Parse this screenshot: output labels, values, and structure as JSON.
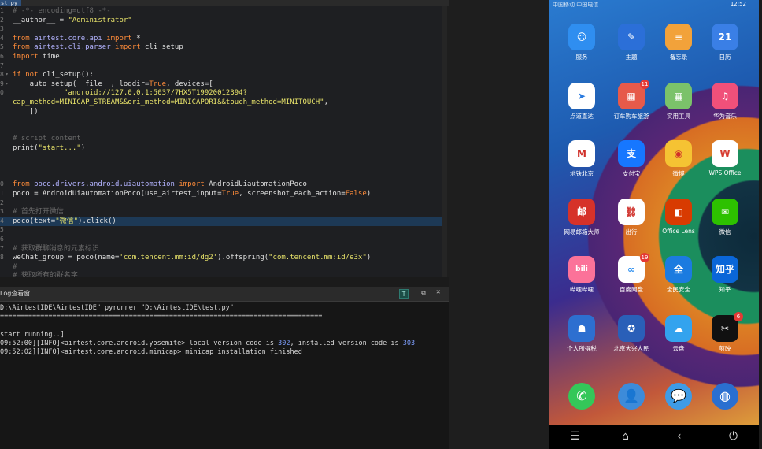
{
  "ide": {
    "tab_label": "st.py",
    "editor_lines": [
      {
        "n": "1",
        "parts": [
          [
            "cmt",
            "# -*- encoding=utf8 -*-"
          ]
        ]
      },
      {
        "n": "2",
        "parts": [
          [
            "plain",
            "__author__ = "
          ],
          [
            "str",
            "\"Administrator\""
          ]
        ]
      },
      {
        "n": "3",
        "parts": []
      },
      {
        "n": "4",
        "parts": [
          [
            "kw",
            "from "
          ],
          [
            "mod",
            "airtest.core.api"
          ],
          [
            "kw",
            " import "
          ],
          [
            "plain",
            "*"
          ]
        ]
      },
      {
        "n": "5",
        "parts": [
          [
            "kw",
            "from "
          ],
          [
            "mod",
            "airtest.cli.parser"
          ],
          [
            "kw",
            " import "
          ],
          [
            "plain",
            "cli_setup"
          ]
        ]
      },
      {
        "n": "6",
        "parts": [
          [
            "kw",
            "import "
          ],
          [
            "plain",
            "time"
          ]
        ]
      },
      {
        "n": "7",
        "parts": []
      },
      {
        "n": "8",
        "fold": true,
        "parts": [
          [
            "kw",
            "if not "
          ],
          [
            "plain",
            "cli_setup():"
          ]
        ]
      },
      {
        "n": "9",
        "fold": true,
        "parts": [
          [
            "plain",
            "    auto_setup(__file__, logdir="
          ],
          [
            "kw",
            "True"
          ],
          [
            "plain",
            ", devices=["
          ]
        ]
      },
      {
        "n": "0",
        "parts": [
          [
            "str",
            "            \"android://127.0.0.1:5037/7HX5T19920012394?"
          ]
        ]
      },
      {
        "n": "",
        "parts": [
          [
            "str",
            "cap_method=MINICAP_STREAM&&ori_method=MINICAPORI&&touch_method=MINITOUCH\""
          ],
          [
            "plain",
            ","
          ]
        ]
      },
      {
        "n": "",
        "parts": [
          [
            "plain",
            "    ])"
          ]
        ]
      },
      {
        "n": "",
        "parts": []
      },
      {
        "n": "",
        "parts": []
      },
      {
        "n": "",
        "parts": [
          [
            "cmt",
            "# script content"
          ]
        ]
      },
      {
        "n": "",
        "parts": [
          [
            "plain",
            "print("
          ],
          [
            "str",
            "\"start...\""
          ],
          [
            "plain",
            ")"
          ]
        ]
      },
      {
        "n": "",
        "parts": []
      },
      {
        "n": "",
        "parts": []
      },
      {
        "n": "",
        "parts": []
      },
      {
        "n": "0",
        "parts": [
          [
            "kw",
            "from "
          ],
          [
            "mod",
            "poco.drivers.android.uiautomation"
          ],
          [
            "kw",
            " import "
          ],
          [
            "plain",
            "AndroidUiautomationPoco"
          ]
        ]
      },
      {
        "n": "1",
        "parts": [
          [
            "plain",
            "poco = AndroidUiautomationPoco(use_airtest_input="
          ],
          [
            "kw",
            "True"
          ],
          [
            "plain",
            ", screenshot_each_action="
          ],
          [
            "kw",
            "False"
          ],
          [
            "plain",
            ")"
          ]
        ]
      },
      {
        "n": "2",
        "parts": []
      },
      {
        "n": "3",
        "parts": [
          [
            "cmt",
            "# 首先打开微信"
          ]
        ]
      },
      {
        "n": "4",
        "hl": true,
        "parts": [
          [
            "plain",
            "poco(text="
          ],
          [
            "str",
            "\"微信\""
          ],
          [
            "plain",
            ").click()"
          ]
        ]
      },
      {
        "n": "5",
        "parts": []
      },
      {
        "n": "6",
        "parts": []
      },
      {
        "n": "7",
        "parts": [
          [
            "cmt",
            "# 获取群聊消息的元素标识"
          ]
        ]
      },
      {
        "n": "8",
        "parts": [
          [
            "plain",
            "weChat_group = poco(name="
          ],
          [
            "str",
            "'com.tencent.mm:id/dg2'"
          ],
          [
            "plain",
            ").offspring("
          ],
          [
            "str",
            "\"com.tencent.mm:id/e3x\""
          ],
          [
            "plain",
            ")"
          ]
        ]
      },
      {
        "n": "",
        "parts": [
          [
            "cmt",
            "#"
          ]
        ]
      },
      {
        "n": "",
        "parts": [
          [
            "cmt",
            "# 获取所有的群名字"
          ]
        ]
      }
    ]
  },
  "log": {
    "title": "Log查看窗",
    "btn_t": "T",
    "restore_icon": "⧉",
    "close_icon": "✕",
    "lines": [
      [
        [
          "plain",
          "D:\\AirtestIDE\\AirtestIDE\" pyrunner \"D:\\AirtestIDE\\test.py\""
        ]
      ],
      [
        [
          "plain",
          "================================================================================"
        ]
      ],
      [],
      [
        [
          "plain",
          "start running..]"
        ]
      ],
      [
        [
          "plain",
          "09:52:00][INFO]<airtest.core.android.yosemite> local version code is "
        ],
        [
          "num",
          "302"
        ],
        [
          "plain",
          ", installed version code is "
        ],
        [
          "num",
          "303"
        ]
      ],
      [
        [
          "plain",
          "09:52:02][INFO]<airtest.core.android.minicap> minicap installation finished"
        ]
      ]
    ]
  },
  "phone": {
    "status_left": "中国移动 中国电信",
    "status_time": "12:52",
    "apps": [
      {
        "name": "app-service",
        "label": "服务",
        "icon": "☺",
        "color": "#2f8ef0",
        "col": 0,
        "row": 0
      },
      {
        "name": "app-theme",
        "label": "主题",
        "icon": "✎",
        "color": "#2b6fd8",
        "col": 1,
        "row": 0
      },
      {
        "name": "app-memo",
        "label": "备忘录",
        "icon": "≡",
        "color": "#f2a23a",
        "col": 2,
        "row": 0
      },
      {
        "name": "app-calendar",
        "label": "日历",
        "icon": "21",
        "color": "#3a7fe6",
        "col": 3,
        "row": 0
      },
      {
        "name": "app-direct",
        "label": "点道直达",
        "icon": "➤",
        "color": "#ffffff",
        "fg": "#2a7be0",
        "col": 0,
        "row": 1
      },
      {
        "name": "app-train",
        "label": "订车购车旅游",
        "icon": "▦",
        "color": "#e65a4a",
        "col": 1,
        "row": 1,
        "badge": "11"
      },
      {
        "name": "app-tools",
        "label": "实用工具",
        "icon": "▦",
        "color": "#7bc26a",
        "col": 2,
        "row": 1
      },
      {
        "name": "app-music",
        "label": "华为音乐",
        "icon": "♫",
        "color": "#f0507a",
        "col": 3,
        "row": 1
      },
      {
        "name": "app-metro",
        "label": "地铁北京",
        "icon": "M",
        "color": "#ffffff",
        "fg": "#d0302a",
        "col": 0,
        "row": 2
      },
      {
        "name": "app-alipay",
        "label": "支付宝",
        "icon": "支",
        "color": "#1677ff",
        "col": 1,
        "row": 2
      },
      {
        "name": "app-weibo",
        "label": "微博",
        "icon": "◉",
        "color": "#f5c333",
        "fg": "#d0302a",
        "col": 2,
        "row": 2
      },
      {
        "name": "app-wps",
        "label": "WPS Office",
        "icon": "W",
        "color": "#ffffff",
        "fg": "#d63b2f",
        "col": 3,
        "row": 2
      },
      {
        "name": "app-post",
        "label": "网易邮箱大师",
        "icon": "邮",
        "color": "#d6322a",
        "col": 0,
        "row": 3
      },
      {
        "name": "app-trip",
        "label": "出行",
        "icon": "⛓",
        "color": "#ffffff",
        "fg": "#d0302a",
        "col": 1,
        "row": 3
      },
      {
        "name": "app-office-lens",
        "label": "Office Lens",
        "icon": "◧",
        "color": "#d83b01",
        "col": 2,
        "row": 3
      },
      {
        "name": "app-wechat",
        "label": "微信",
        "icon": "✉",
        "color": "#2dc100",
        "col": 3,
        "row": 3
      },
      {
        "name": "app-bilibili",
        "label": "哔哩哔哩",
        "icon": "bili",
        "color": "#fb7299",
        "col": 0,
        "row": 4
      },
      {
        "name": "app-baidu-disk",
        "label": "百度网盘",
        "icon": "∞",
        "color": "#ffffff",
        "fg": "#2a8ef0",
        "col": 1,
        "row": 4,
        "badge": "19"
      },
      {
        "name": "app-quanmian",
        "label": "全民安全",
        "icon": "全",
        "color": "#1b7be0",
        "col": 2,
        "row": 4
      },
      {
        "name": "app-zhihu",
        "label": "知乎",
        "icon": "知乎",
        "color": "#0a66d8",
        "col": 3,
        "row": 4
      },
      {
        "name": "app-antifraud",
        "label": "个人所得税",
        "icon": "☗",
        "color": "#2d6fd0",
        "col": 0,
        "row": 5
      },
      {
        "name": "app-police",
        "label": "北京大兴人民",
        "icon": "✪",
        "color": "#2a5fb8",
        "col": 1,
        "row": 5
      },
      {
        "name": "app-cloud",
        "label": "云盘",
        "icon": "☁",
        "color": "#33a3ee",
        "col": 2,
        "row": 5
      },
      {
        "name": "app-capcut",
        "label": "剪映",
        "icon": "✂",
        "color": "#111111",
        "col": 3,
        "row": 5,
        "badge": "6"
      }
    ],
    "dock": [
      {
        "name": "dock-phone",
        "icon": "✆",
        "color": "#34c759"
      },
      {
        "name": "dock-contacts",
        "icon": "👤",
        "color": "#3d8bd9"
      },
      {
        "name": "dock-messages",
        "icon": "💬",
        "color": "#3e9be6"
      },
      {
        "name": "dock-browser",
        "icon": "◍",
        "color": "#2a6fd0"
      }
    ],
    "nav": {
      "menu": "☰",
      "home": "⌂",
      "back": "‹",
      "power": "⏻"
    }
  }
}
